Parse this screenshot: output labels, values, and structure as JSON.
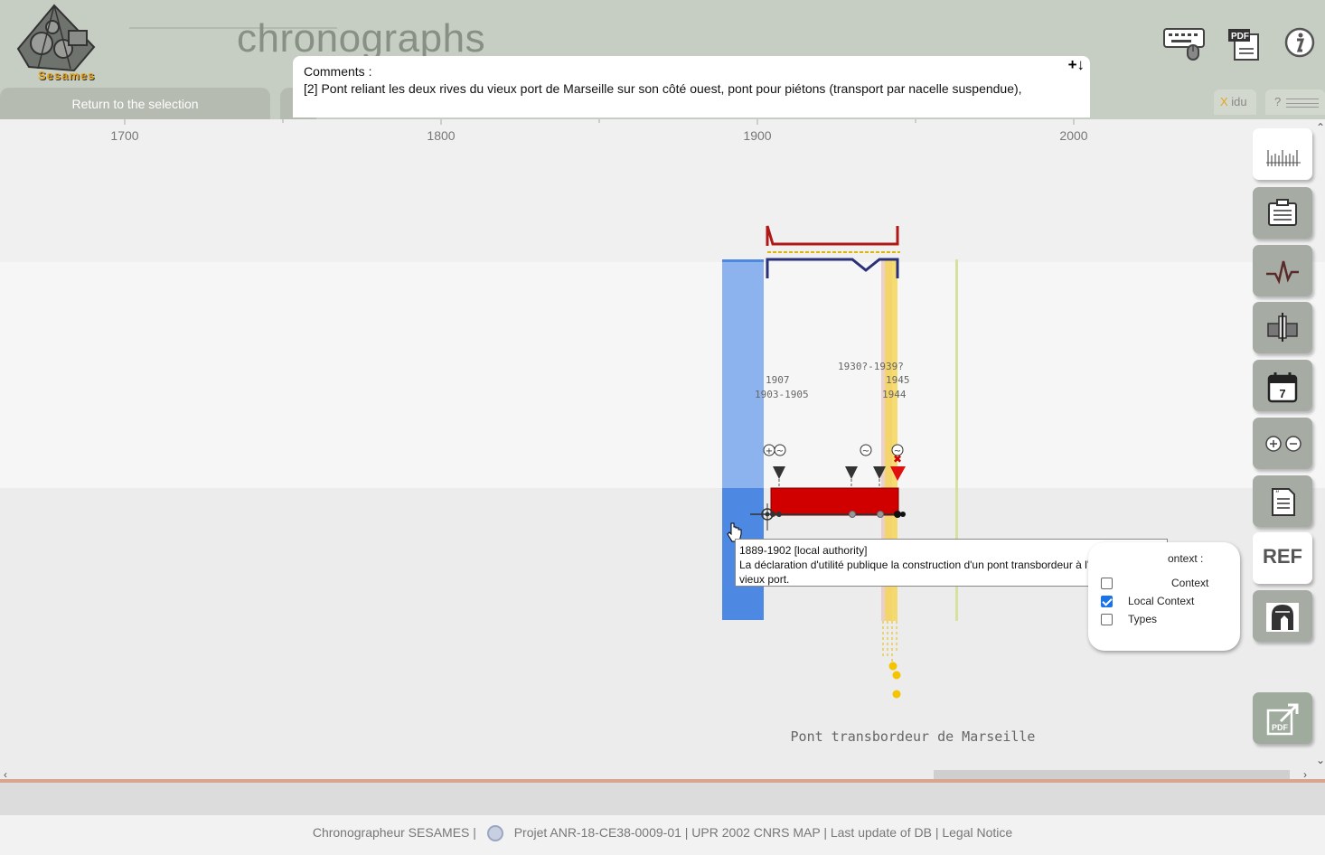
{
  "header": {
    "logo_text": "Sesames",
    "title": "chronographs",
    "return_tab": "Return to the selection",
    "idu_x": "X",
    "idu_label": " idu",
    "help_label": "?",
    "pdf_label": "PDF"
  },
  "comments": {
    "title": "Comments :",
    "text": "[2] Pont reliant les deux rives du vieux port de Marseille sur son côté ouest, pont pour piétons (transport par nacelle suspendue),",
    "control": "+↓"
  },
  "timeline": {
    "ticks": [
      "1700",
      "1800",
      "1900",
      "2000"
    ],
    "labels": [
      "1907",
      "1903-1905",
      "1930?-1939?",
      "1945",
      "1944"
    ],
    "object_name": "Pont transbordeur de Marseille"
  },
  "tooltip": {
    "line1": "1889-1902  [local authority]",
    "line2": "La déclaration d'utilité publique la construction d'un pont transbordeur à l'entrée du vieux port."
  },
  "context_panel": {
    "title": "ontext :",
    "items": [
      {
        "label": "Context",
        "checked": false
      },
      {
        "label": "Local Context",
        "checked": true
      },
      {
        "label": "Types",
        "checked": false
      }
    ]
  },
  "sidebar": {
    "ref_label": "REF",
    "pdf_label": "PDF",
    "calendar_day": "7"
  },
  "footer": {
    "part1": "Chronographeur SESAMES |",
    "part2": "Projet ANR-18-CE38-0009-01 | UPR 2002 CNRS MAP | Last update of DB | Legal Notice"
  },
  "colors": {
    "header_bg": "#c6cdc2",
    "event_red": "#d00000",
    "range_blue": "#4d88e3",
    "yellow": "#f5c400",
    "navy": "#2a2f7a"
  }
}
